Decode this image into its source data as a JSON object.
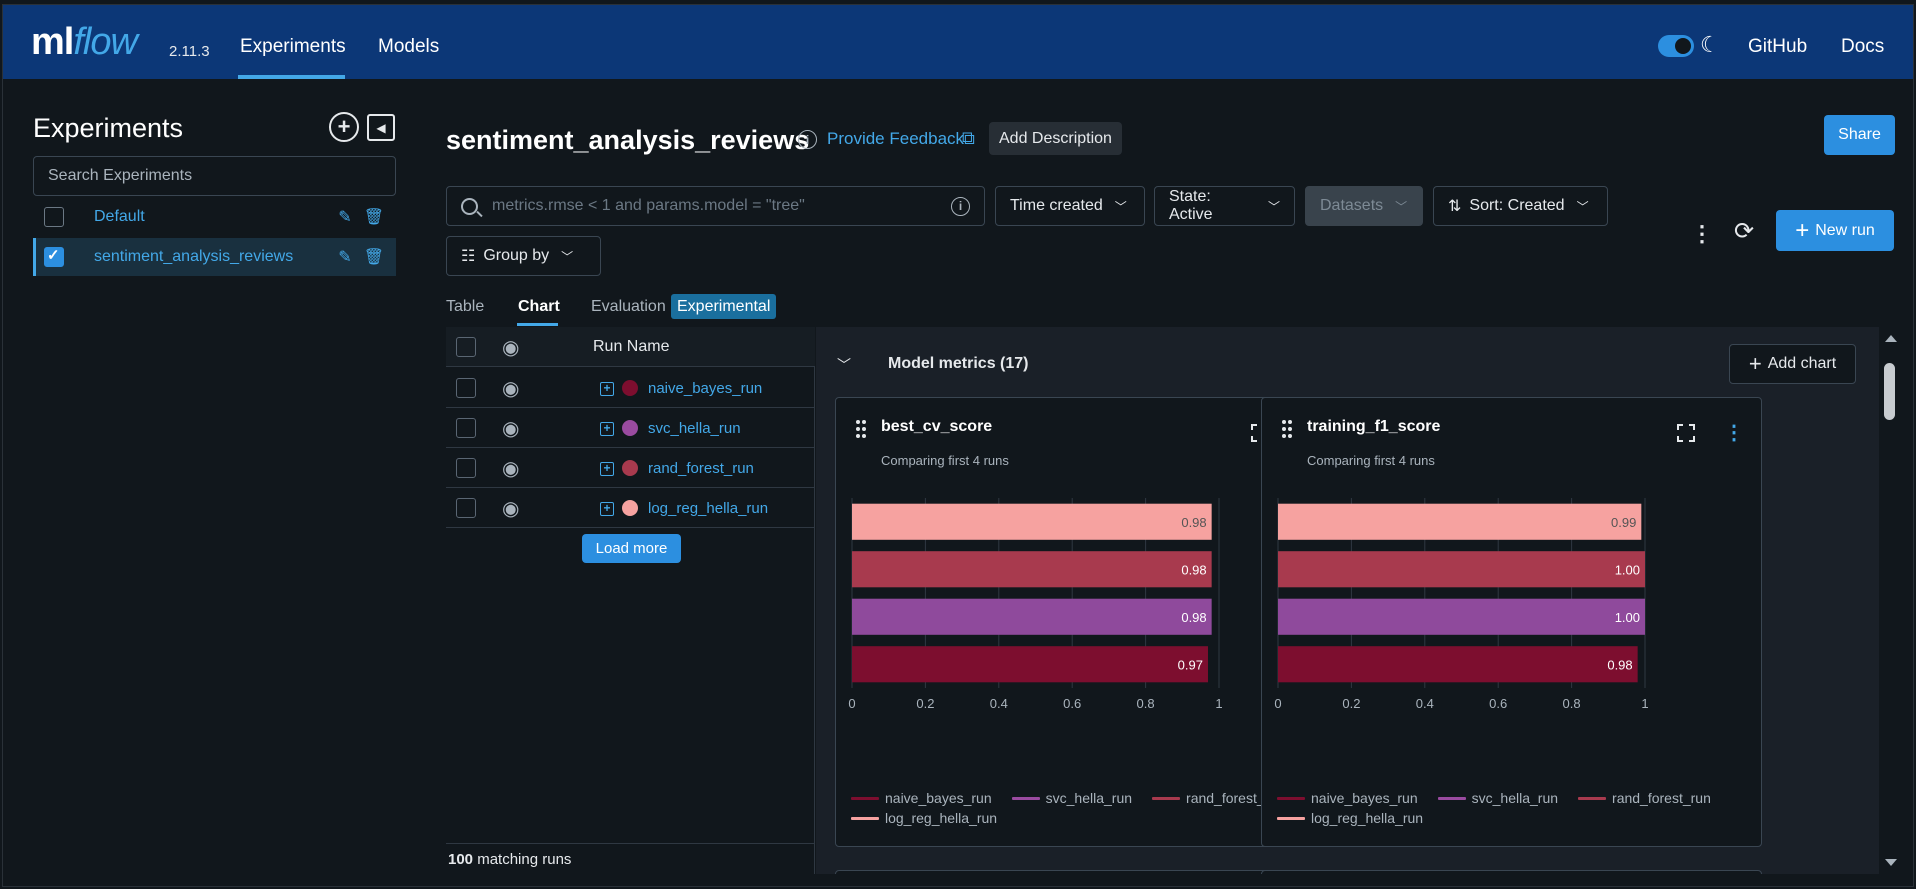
{
  "topbar": {
    "logo_ml": "ml",
    "logo_flow": "flow",
    "version": "2.11.3",
    "nav": [
      "Experiments",
      "Models"
    ],
    "links": [
      "GitHub",
      "Docs"
    ]
  },
  "sidebar": {
    "title": "Experiments",
    "search_placeholder": "Search Experiments",
    "experiments": [
      {
        "name": "Default",
        "checked": false
      },
      {
        "name": "sentiment_analysis_reviews",
        "checked": true
      }
    ]
  },
  "main": {
    "title": "sentiment_analysis_reviews",
    "feedback": "Provide Feedback",
    "add_description": "Add Description",
    "share": "Share",
    "search_placeholder": "metrics.rmse < 1 and params.model = \"tree\"",
    "filters": {
      "time": "Time created",
      "state": "State: Active",
      "datasets": "Datasets",
      "sort": "Sort: Created",
      "group": "Group by"
    },
    "new_run": "New run",
    "tabs": [
      "Table",
      "Chart",
      "Evaluation"
    ],
    "experimental_badge": "Experimental"
  },
  "runs": {
    "column": "Run Name",
    "items": [
      {
        "name": "naive_bayes_run",
        "color": "#7d0e2f"
      },
      {
        "name": "svc_hella_run",
        "color": "#9a4ba0"
      },
      {
        "name": "rand_forest_run",
        "color": "#a83a4e"
      },
      {
        "name": "log_reg_hella_run",
        "color": "#f6a2a0"
      }
    ],
    "load_more": "Load more",
    "matching_count": "100",
    "matching_label": "matching runs"
  },
  "charts_section": {
    "title": "Model metrics (17)",
    "add_chart": "Add chart"
  },
  "chart_data": [
    {
      "type": "bar",
      "orientation": "horizontal",
      "title": "best_cv_score",
      "subtitle": "Comparing first 4 runs",
      "categories": [
        "log_reg_hella_run",
        "rand_forest_run",
        "svc_hella_run",
        "naive_bayes_run"
      ],
      "values": [
        0.98,
        0.98,
        0.98,
        0.97
      ],
      "labels": [
        "0.98",
        "0.98",
        "0.98",
        "0.97"
      ],
      "colors": [
        "#f6a2a0",
        "#a83a4e",
        "#8f4a9c",
        "#7d0e2f"
      ],
      "xlim": [
        0,
        1
      ],
      "xticks": [
        "0",
        "0.2",
        "0.4",
        "0.6",
        "0.8",
        "1"
      ],
      "legend": [
        "naive_bayes_run",
        "svc_hella_run",
        "rand_forest_run",
        "log_reg_hella_run"
      ],
      "legend_colors": [
        "#7d0e2f",
        "#9a4ba0",
        "#a83a4e",
        "#f6a2a0"
      ]
    },
    {
      "type": "bar",
      "orientation": "horizontal",
      "title": "training_f1_score",
      "subtitle": "Comparing first 4 runs",
      "categories": [
        "log_reg_hella_run",
        "rand_forest_run",
        "svc_hella_run",
        "naive_bayes_run"
      ],
      "values": [
        0.99,
        1.0,
        1.0,
        0.98
      ],
      "labels": [
        "0.99",
        "1.00",
        "1.00",
        "0.98"
      ],
      "colors": [
        "#f6a2a0",
        "#a83a4e",
        "#8f4a9c",
        "#7d0e2f"
      ],
      "xlim": [
        0,
        1
      ],
      "xticks": [
        "0",
        "0.2",
        "0.4",
        "0.6",
        "0.8",
        "1"
      ],
      "legend": [
        "naive_bayes_run",
        "svc_hella_run",
        "rand_forest_run",
        "log_reg_hella_run"
      ],
      "legend_colors": [
        "#7d0e2f",
        "#9a4ba0",
        "#a83a4e",
        "#f6a2a0"
      ]
    }
  ]
}
